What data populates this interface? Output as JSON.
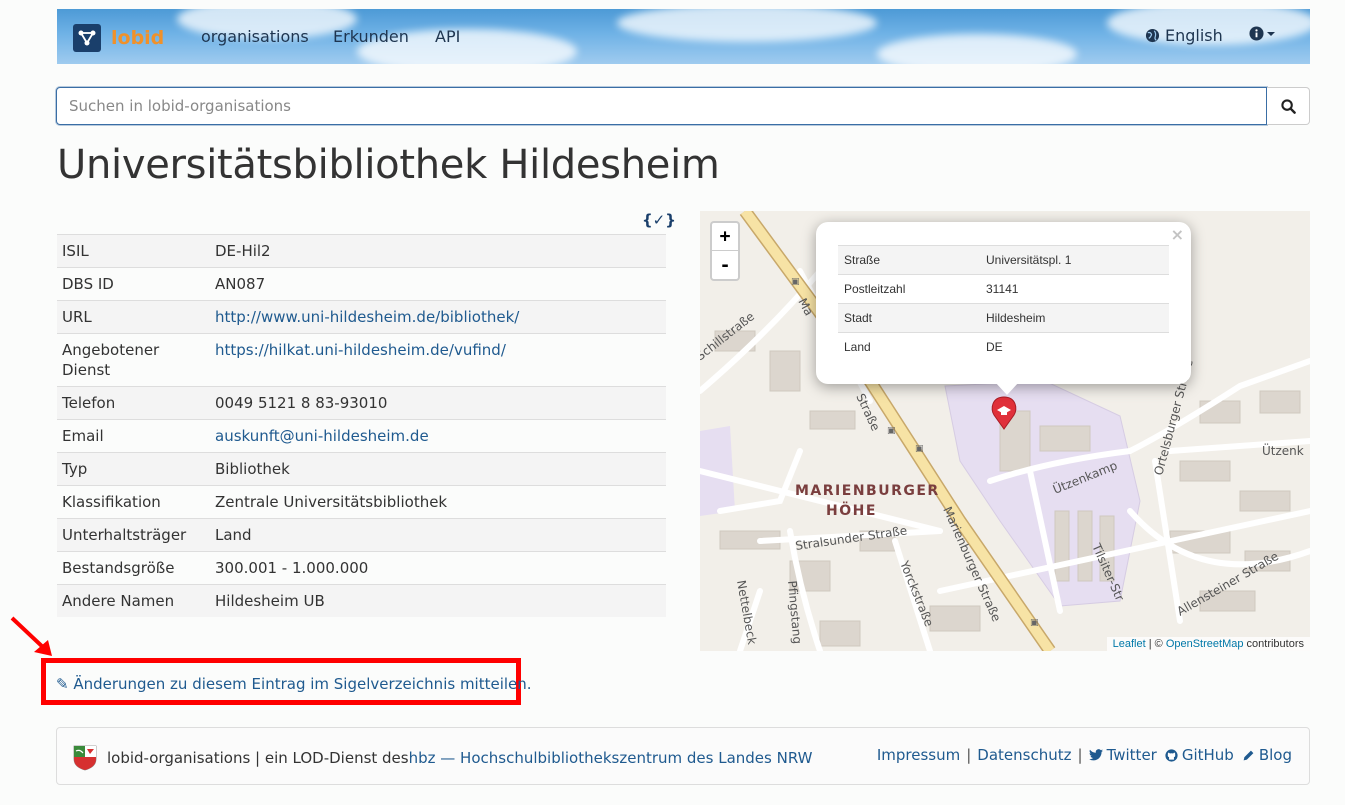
{
  "navbar": {
    "brand": "lobid",
    "links": [
      "organisations",
      "Erkunden",
      "API"
    ],
    "language": "English"
  },
  "search": {
    "placeholder": "Suchen in lobid-organisations"
  },
  "page_title": "Universitätsbibliothek Hildesheim",
  "json_icon": "{✓}",
  "info_rows": [
    {
      "key": "ISIL",
      "value": "DE-Hil2",
      "link": false
    },
    {
      "key": "DBS ID",
      "value": "AN087",
      "link": false
    },
    {
      "key": "URL",
      "value": "http://www.uni-hildesheim.de/bibliothek/",
      "link": true
    },
    {
      "key": "Angebotener Dienst",
      "value": "https://hilkat.uni-hildesheim.de/vufind/",
      "link": true
    },
    {
      "key": "Telefon",
      "value": "0049 5121 8 83-93010",
      "link": false
    },
    {
      "key": "Email",
      "value": "auskunft@uni-hildesheim.de",
      "link": true
    },
    {
      "key": "Typ",
      "value": "Bibliothek",
      "link": false
    },
    {
      "key": "Klassifikation",
      "value": "Zentrale Universitätsbibliothek",
      "link": false
    },
    {
      "key": "Unterhaltsträger",
      "value": "Land",
      "link": false
    },
    {
      "key": "Bestandsgröße",
      "value": "300.001 - 1.000.000",
      "link": false
    },
    {
      "key": "Andere Namen",
      "value": "Hildesheim UB",
      "link": false
    }
  ],
  "map": {
    "zoom_in": "+",
    "zoom_out": "-",
    "popup_close": "×",
    "popup_rows": [
      {
        "key": "Straße",
        "value": "Universitätspl. 1"
      },
      {
        "key": "Postleitzahl",
        "value": "31141"
      },
      {
        "key": "Stadt",
        "value": "Hildesheim"
      },
      {
        "key": "Land",
        "value": "DE"
      }
    ],
    "labels": {
      "district_1": "MARIENBURGER",
      "district_2": "HÖHE",
      "schillstrasse": "Schillstraße",
      "marienburger_top": "Ma",
      "strasse_vertical": "Straße",
      "ortelsburger": "Ortelsburger Straße",
      "utzenk": "Ützenk",
      "utzenkamp": "Ützenkamp",
      "stralsunder": "Stralsunder Straße",
      "marienburger_strasse": "Marienburger Straße",
      "yorckstrasse": "Yorckstraße",
      "tilsiter": "Tilsiter-Str",
      "allensteiner": "Allensteiner Straße",
      "nettelbeck": "Nettelbeck",
      "pfingstanger": "Pfingstang"
    },
    "attribution_leaflet": "Leaflet",
    "attribution_sep": " | © ",
    "attribution_osm": "OpenStreetMap",
    "attribution_rest": " contributors"
  },
  "edit_link": "✎ Änderungen zu diesem Eintrag im Sigelverzeichnis mitteilen.",
  "footer": {
    "text_prefix": "lobid-organisations | ein LOD-Dienst des ",
    "hbz_link": "hbz — Hochschulbibliothekszentrum des Landes NRW",
    "links": [
      "Impressum",
      "Datenschutz",
      "Twitter",
      "GitHub",
      "Blog"
    ]
  },
  "colors": {
    "brand_orange": "#f0912a",
    "link_blue": "#1f5a8f",
    "highlight_red": "#ff0000",
    "marker_red": "#e0303a"
  }
}
